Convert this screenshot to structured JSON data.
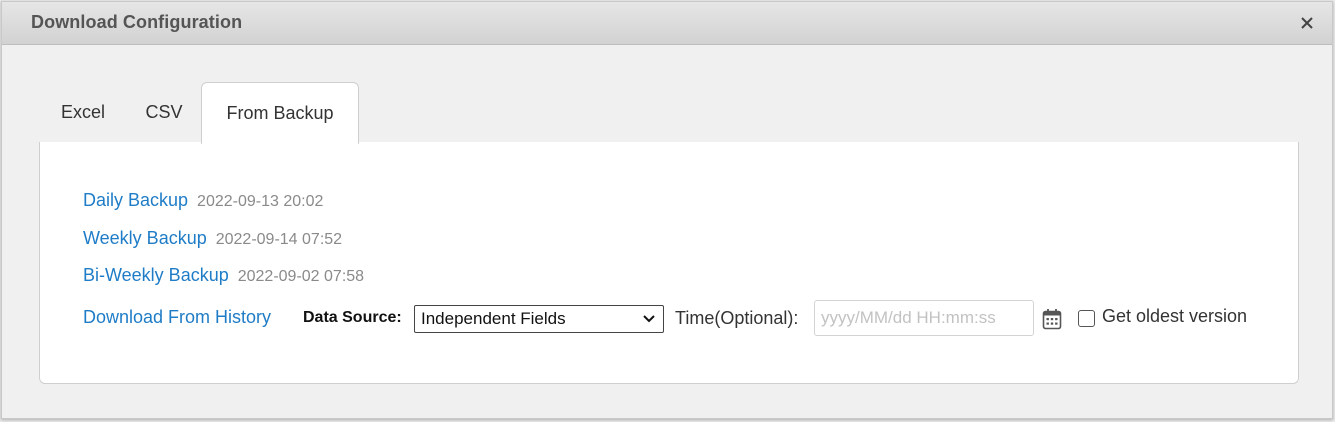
{
  "dialog": {
    "title": "Download Configuration",
    "close_icon": "close-icon"
  },
  "tabs": [
    {
      "label": "Excel",
      "active": false
    },
    {
      "label": "CSV",
      "active": false
    },
    {
      "label": "From Backup",
      "active": true
    }
  ],
  "backups": [
    {
      "label": "Daily Backup",
      "timestamp": "2022-09-13 20:02"
    },
    {
      "label": "Weekly Backup",
      "timestamp": "2022-09-14 07:52"
    },
    {
      "label": "Bi-Weekly Backup",
      "timestamp": "2022-09-02 07:58"
    }
  ],
  "history": {
    "link_label": "Download From History",
    "data_source_label": "Data Source:",
    "data_source_value": "Independent Fields",
    "time_label": "Time(Optional):",
    "time_placeholder": "yyyy/MM/dd HH:mm:ss",
    "time_value": "",
    "calendar_icon": "calendar-icon",
    "oldest_label": "Get oldest version",
    "oldest_checked": false
  },
  "colors": {
    "link": "#1f7cc7",
    "timestamp": "#8a8a8a",
    "titlebar": "#d9d9d9"
  }
}
